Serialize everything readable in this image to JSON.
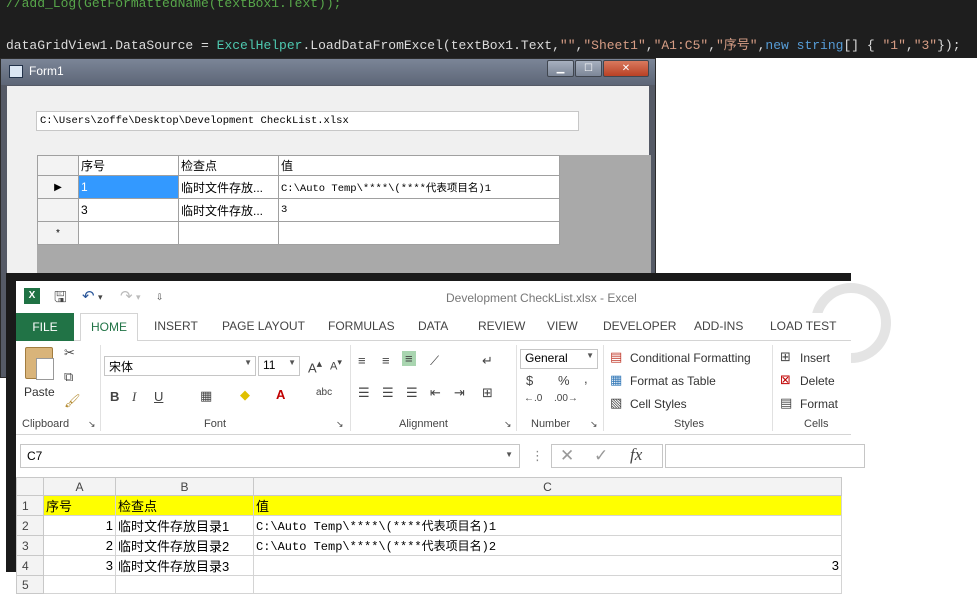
{
  "editor": {
    "line1": "//add_Log(GetFormattedName(textBox1.Text));",
    "line2_parts": {
      "a": "dataGridView1.DataSource = ",
      "b": "ExcelHelper",
      "c": ".LoadDataFromExcel(textBox1.Text,",
      "d": "\"\"",
      "e": ",",
      "f": "\"Sheet1\"",
      "g": ",",
      "h": "\"A1:C5\"",
      "i": ",",
      "j": "\"序号\"",
      "k": ",",
      "l": "new",
      "m": " ",
      "n": "string",
      "o": "[] { ",
      "p": "\"1\"",
      "q": ",",
      "r": "\"3\"",
      "s": "});"
    }
  },
  "form1": {
    "title": "Form1",
    "path_value": "C:\\Users\\zoffe\\Desktop\\Development CheckList.xlsx",
    "grid": {
      "headers": [
        "序号",
        "检查点",
        "值"
      ],
      "rows": [
        {
          "marker": "▶",
          "cells": [
            "1",
            "临时文件存放...",
            "C:\\Auto Temp\\****\\(****代表项目名)1"
          ]
        },
        {
          "marker": "",
          "cells": [
            "3",
            "临时文件存放...",
            "3"
          ]
        },
        {
          "marker": "*",
          "cells": [
            "",
            "",
            ""
          ]
        }
      ]
    }
  },
  "excel": {
    "title": "Development CheckList.xlsx - Excel",
    "tabs": [
      "FILE",
      "HOME",
      "INSERT",
      "PAGE LAYOUT",
      "FORMULAS",
      "DATA",
      "REVIEW",
      "VIEW",
      "DEVELOPER",
      "ADD-INS",
      "LOAD TEST"
    ],
    "ribbon": {
      "paste": "Paste",
      "font_name": "宋体",
      "font_size": "11",
      "number_format": "General",
      "conditional_formatting": "Conditional Formatting",
      "format_as_table": "Format as Table",
      "cell_styles": "Cell Styles",
      "insert": "Insert",
      "delete": "Delete",
      "format": "Format",
      "groups": [
        "Clipboard",
        "Font",
        "Alignment",
        "Number",
        "Styles",
        "Cells"
      ]
    },
    "namebox": "C7",
    "fx": "fx",
    "columns": [
      "A",
      "B",
      "C"
    ],
    "rows": [
      {
        "n": "1",
        "a": "序号",
        "b": "检查点",
        "c": "值",
        "header": true
      },
      {
        "n": "2",
        "a": "1",
        "b": "临时文件存放目录1",
        "c": "C:\\Auto Temp\\****\\(****代表项目名)1"
      },
      {
        "n": "3",
        "a": "2",
        "b": "临时文件存放目录2",
        "c": "C:\\Auto Temp\\****\\(****代表项目名)2"
      },
      {
        "n": "4",
        "a": "3",
        "b": "临时文件存放目录3",
        "c": "3"
      },
      {
        "n": "5",
        "a": "",
        "b": "",
        "c": ""
      }
    ],
    "colors": {
      "accent": "#217346",
      "header_fill": "#ffff00"
    }
  }
}
